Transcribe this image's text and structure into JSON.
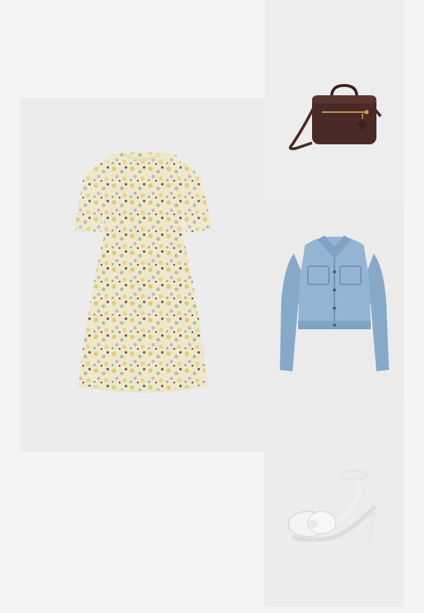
{
  "outfit": {
    "items": [
      {
        "id": "dress",
        "icon": "dress-icon",
        "colors": [
          "#efe6c8",
          "#d9cf7a",
          "#a7c29a",
          "#6b4a55",
          "#c9b2c8"
        ]
      },
      {
        "id": "bag",
        "icon": "bag-icon",
        "colors": [
          "#4a2a26",
          "#c8a24a"
        ]
      },
      {
        "id": "jacket",
        "icon": "jacket-icon",
        "colors": [
          "#8fb1cf",
          "#6e93b8"
        ]
      },
      {
        "id": "sandal",
        "icon": "sandal-icon",
        "colors": [
          "#f2f2f2",
          "#d8d8d8"
        ]
      }
    ]
  },
  "colors": {
    "page_background": "#f4f4f4",
    "tile_background": "#ececec"
  }
}
